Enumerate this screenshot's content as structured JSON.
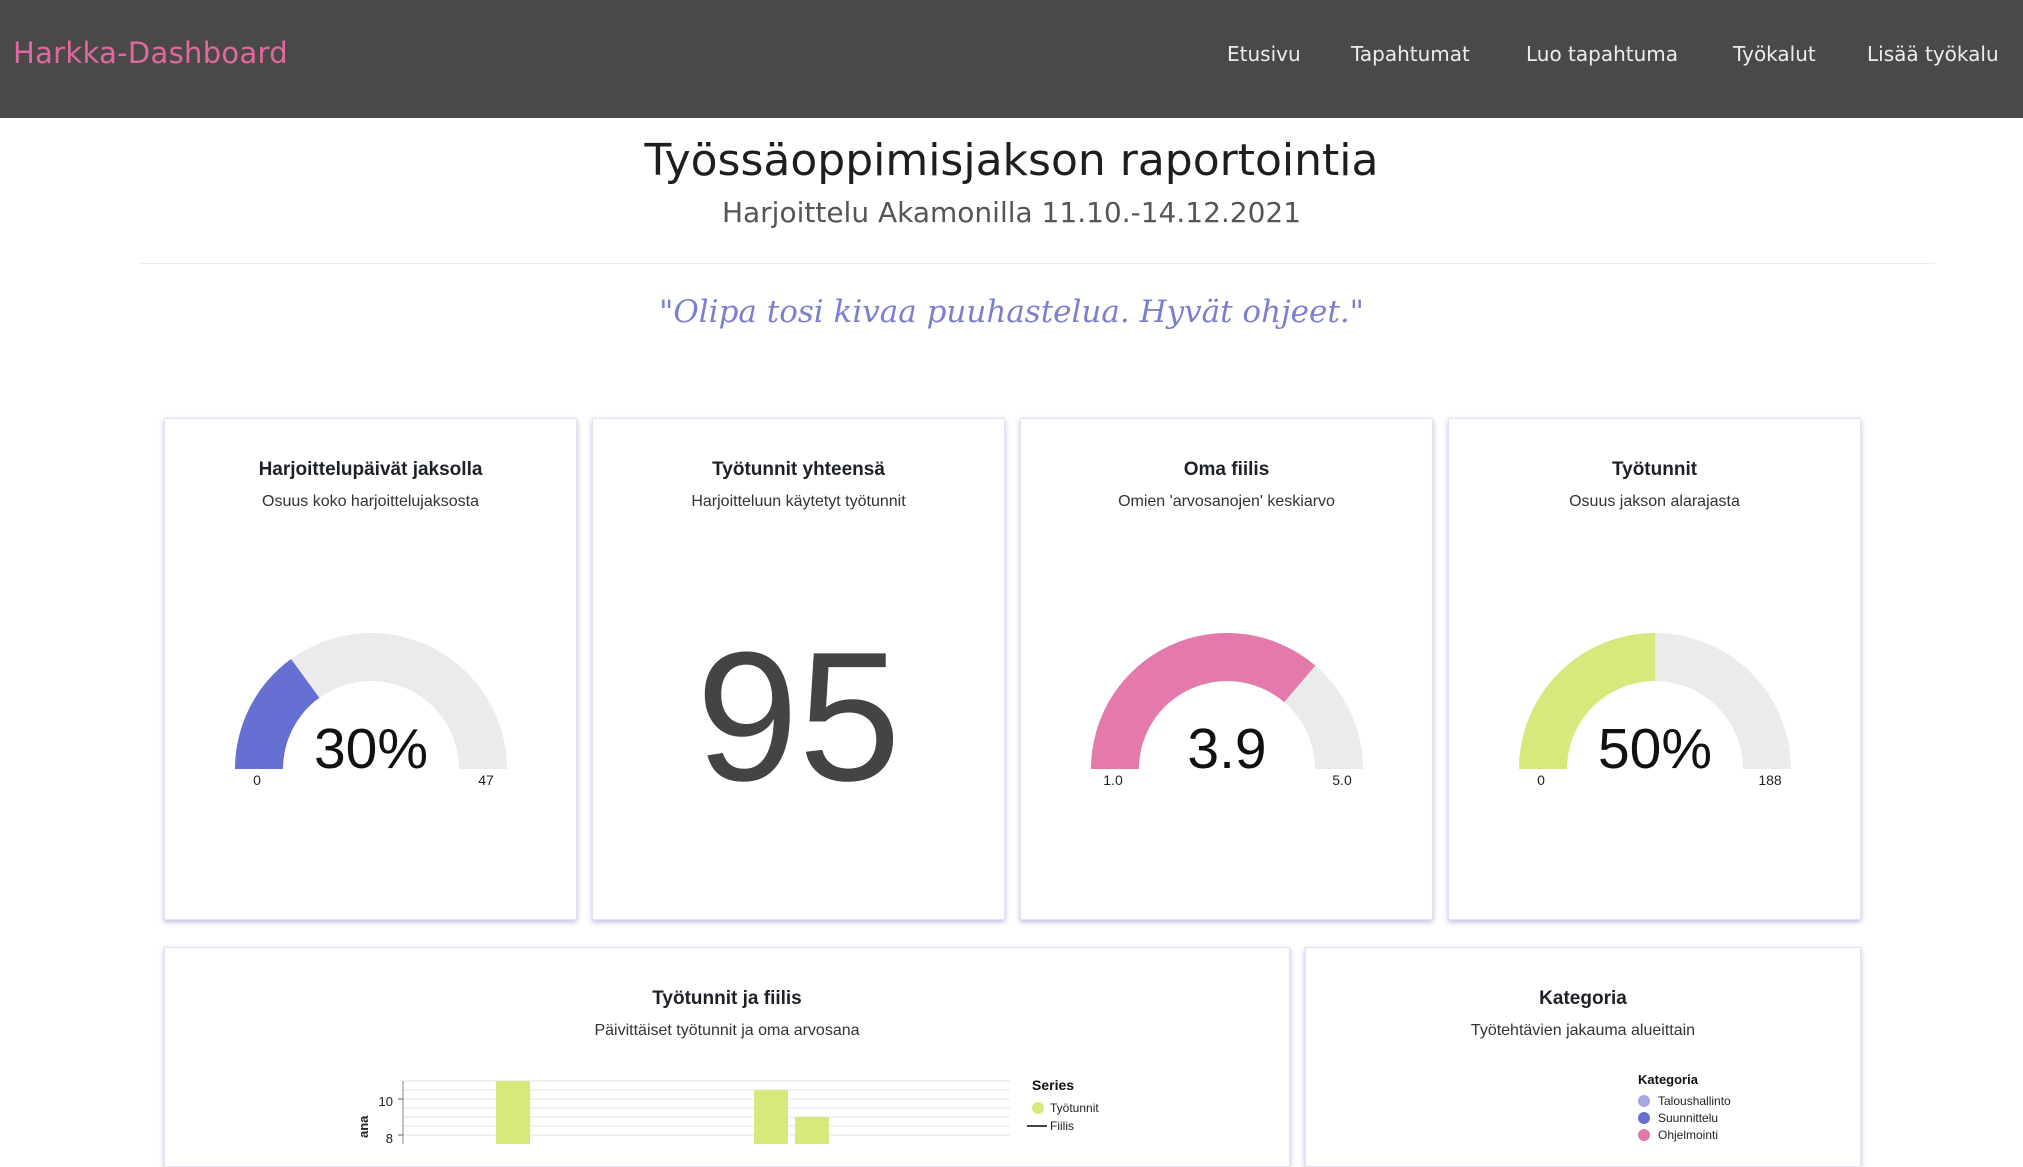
{
  "navbar": {
    "brand": "Harkka-Dashboard",
    "links": [
      "Etusivu",
      "Tapahtumat",
      "Luo tapahtuma",
      "Työkalut",
      "Lisää työkalu"
    ]
  },
  "header": {
    "title": "Työssäoppimisjakson raportointia",
    "subtitle": "Harjoittelu Akamonilla 11.10.-14.12.2021"
  },
  "quote": "\"Olipa tosi kivaa puuhastelua. Hyvät ohjeet.\"",
  "cards": {
    "days": {
      "title": "Harjoittelupäivät jaksolla",
      "subtitle": "Osuus koko harjoittelujaksosta",
      "value": "30%",
      "min": "0",
      "max": "47",
      "fraction": 0.3,
      "color": "#6570d2"
    },
    "hours_total": {
      "title": "Työtunnit yhteensä",
      "subtitle": "Harjoitteluun käytetyt työtunnit",
      "value": "95"
    },
    "mood": {
      "title": "Oma fiilis",
      "subtitle": "Omien 'arvosanojen' keskiarvo",
      "value": "3.9",
      "min": "1.0",
      "max": "5.0",
      "fraction": 0.725,
      "color": "#e479ac"
    },
    "hours_share": {
      "title": "Työtunnit",
      "subtitle": "Osuus jakson alarajasta",
      "value": "50%",
      "min": "0",
      "max": "188",
      "fraction": 0.5,
      "color": "#d7e97c"
    }
  },
  "chart_card": {
    "title": "Työtunnit ja fiilis",
    "subtitle": "Päivittäiset työtunnit ja oma arvosana",
    "ylabel_fragment": "ana",
    "legend_title": "Series",
    "legend_items": [
      "Työtunnit",
      "Fiilis"
    ],
    "bar_color": "#d7e97c"
  },
  "category_card": {
    "title": "Kategoria",
    "subtitle": "Työtehtävien jakauma alueittain",
    "legend_title": "Kategoria",
    "legend_items": [
      {
        "label": "Taloushallinto",
        "color": "#a9a7e3"
      },
      {
        "label": "Suunnittelu",
        "color": "#6570d2"
      },
      {
        "label": "Ohjelmointi",
        "color": "#e479ac"
      }
    ]
  },
  "chart_data": {
    "type": "bar",
    "title": "Työtunnit ja fiilis",
    "ylabel": "ana",
    "yticks": [
      "10",
      "8"
    ],
    "ylim": [
      7.5,
      11
    ],
    "series": [
      {
        "name": "Työtunnit",
        "values": [
          11,
          10.5,
          9
        ]
      }
    ],
    "grid": true,
    "legend": "right"
  }
}
